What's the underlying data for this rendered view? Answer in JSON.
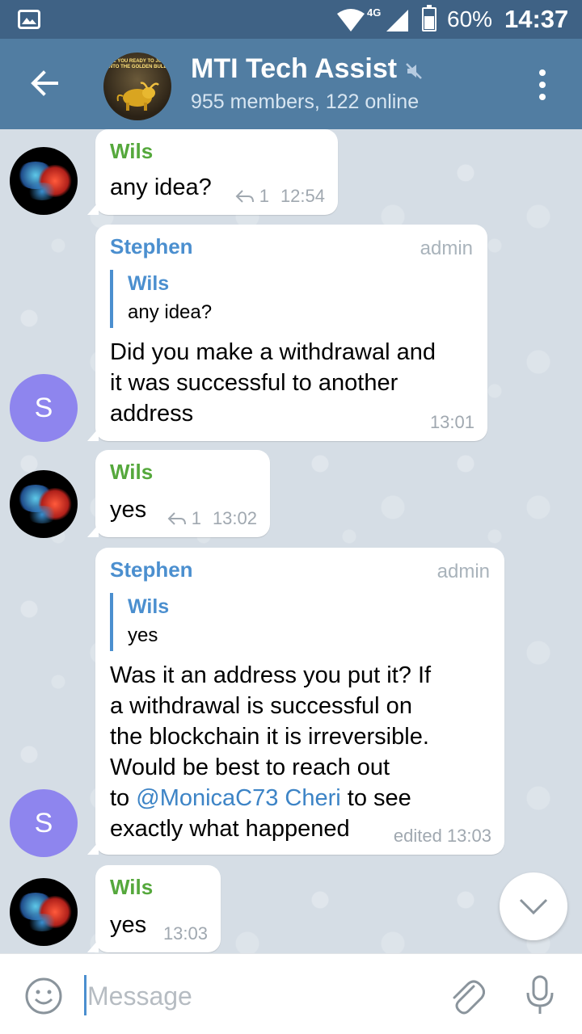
{
  "status_bar": {
    "network": "4G",
    "battery_percent": "60%",
    "battery_level": 0.6,
    "time": "14:37"
  },
  "header": {
    "title": "MTI Tech Assist",
    "subtitle": "955 members, 122 online",
    "avatar_text": "ARE YOU READY TO JUMP ONTO THE GOLDEN BULL?"
  },
  "messages": [
    {
      "sender": "Wils",
      "text": "any idea?",
      "reply_count": "1",
      "time": "12:54"
    },
    {
      "sender": "Stephen",
      "role": "admin",
      "avatar_letter": "S",
      "quote": {
        "sender": "Wils",
        "text": "any idea?"
      },
      "lines": [
        "Did you make a withdrawal and",
        "it was successful to another",
        "address"
      ],
      "time": "13:01"
    },
    {
      "sender": "Wils",
      "text": "yes",
      "reply_count": "1",
      "time": "13:02"
    },
    {
      "sender": "Stephen",
      "role": "admin",
      "avatar_letter": "S",
      "quote": {
        "sender": "Wils",
        "text": "yes"
      },
      "lines": [
        "Was it an address you put it? If",
        "a withdrawal is successful on",
        "the blockchain it is irreversible.",
        "Would be best to reach out"
      ],
      "line5_pre": "to ",
      "mention": "@MonicaC73 Cheri",
      "line5_post": " to see",
      "line6": "exactly what happened",
      "time": "edited 13:03"
    },
    {
      "sender": "Wils",
      "text": "yes",
      "time": "13:03"
    }
  ],
  "input": {
    "placeholder": "Message"
  },
  "colors": {
    "header": "#517da2",
    "status_bar": "#3f6285",
    "wils_name": "#55a83c",
    "stephen_name": "#4b8fcf",
    "avatar_s": "#8e85ee"
  }
}
